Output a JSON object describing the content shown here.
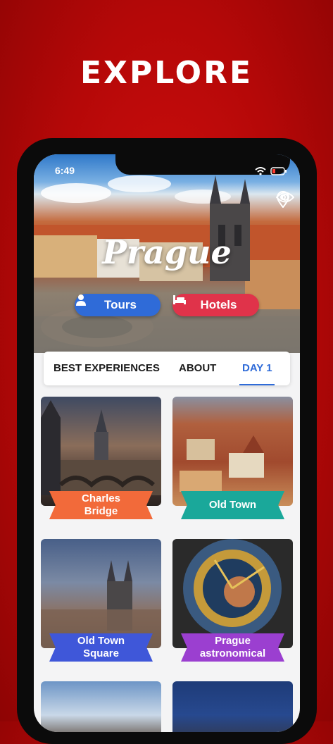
{
  "headline": "EXPLORE",
  "status": {
    "time": "6:49"
  },
  "hero": {
    "city": "Prague",
    "tours_label": "Tours",
    "hotels_label": "Hotels"
  },
  "tabs": [
    "BEST EXPERIENCES",
    "ABOUT",
    "DAY 1"
  ],
  "active_tab": "DAY 1",
  "cards": [
    {
      "title_line1": "Charles",
      "title_line2": "Bridge",
      "ribbon_color": "#f26a3a"
    },
    {
      "title_line1": "Old Town",
      "title_line2": "",
      "ribbon_color": "#1aa89a"
    },
    {
      "title_line1": "Old Town",
      "title_line2": "Square",
      "ribbon_color": "#3f57d9"
    },
    {
      "title_line1": "Prague",
      "title_line2": "astronomical",
      "ribbon_color": "#9b3fd0"
    }
  ],
  "colors": {
    "background": "#c00d0d",
    "accent_blue": "#2f6bd8",
    "accent_red": "#e0334a"
  },
  "icons": [
    "wifi-icon",
    "battery-icon",
    "eye-icon",
    "location-pin-icon",
    "person-icon",
    "bed-icon"
  ]
}
